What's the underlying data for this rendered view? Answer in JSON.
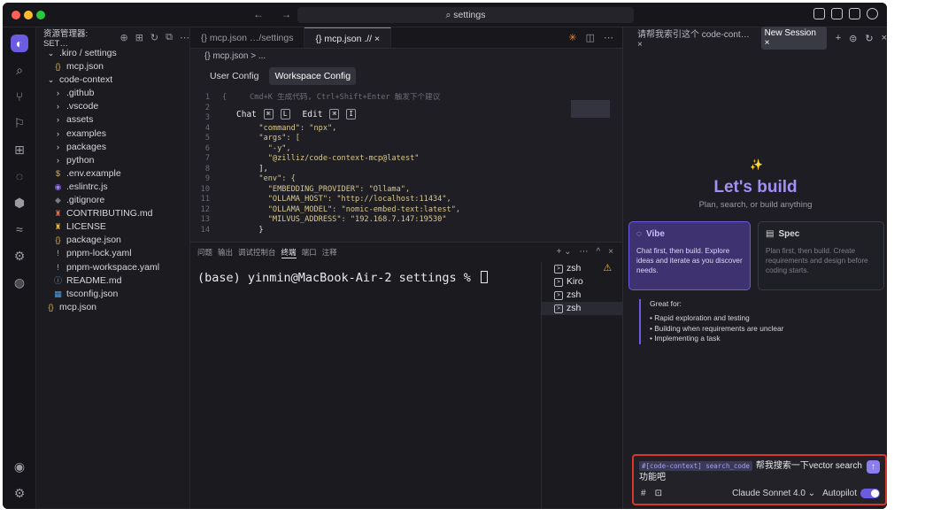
{
  "titlebar": {
    "search_text": "⌕ settings",
    "nav_arrows": "← →",
    "colors": {
      "close": "#ff5f57",
      "minimize": "#febc2e",
      "maximize": "#28c840"
    }
  },
  "activity": {
    "icons": [
      "kiro-logo-icon",
      "search-icon",
      "source-control-icon",
      "run-debug-icon",
      "extensions-icon",
      "ghost-icon",
      "shield-icon",
      "mcp-icon",
      "plugin-icon",
      "power-icon"
    ],
    "glyphs": [
      "◐",
      "⌕",
      "⑂",
      "⚐",
      "⊞",
      "◌",
      "⬢",
      "≈",
      "⚙",
      "◍"
    ],
    "bottom_glyphs": [
      "◉",
      "⚙"
    ]
  },
  "explorer": {
    "title": "资源管理器: SET…",
    "header_icons": [
      "⊕",
      "⊞",
      "↻",
      "⧉",
      "⋯"
    ],
    "items": [
      {
        "indent": 1,
        "icon": "⌄",
        "label": ".kiro / settings",
        "color": "#d6d6dc"
      },
      {
        "indent": 2,
        "icon": "{}",
        "label": "mcp.json",
        "color": "#e3b341"
      },
      {
        "indent": 1,
        "icon": "⌄",
        "label": "code-context",
        "color": "#d6d6dc"
      },
      {
        "indent": 2,
        "icon": "›",
        "label": ".github",
        "color": "#d6d6dc"
      },
      {
        "indent": 2,
        "icon": "›",
        "label": ".vscode",
        "color": "#d6d6dc"
      },
      {
        "indent": 2,
        "icon": "›",
        "label": "assets",
        "color": "#d6d6dc"
      },
      {
        "indent": 2,
        "icon": "›",
        "label": "examples",
        "color": "#d6d6dc"
      },
      {
        "indent": 2,
        "icon": "›",
        "label": "packages",
        "color": "#d6d6dc"
      },
      {
        "indent": 2,
        "icon": "›",
        "label": "python",
        "color": "#d6d6dc"
      },
      {
        "indent": 2,
        "icon": "$",
        "label": ".env.example",
        "color": "#e3b341"
      },
      {
        "indent": 2,
        "icon": "◉",
        "label": ".eslintrc.js",
        "color": "#9b7cf0"
      },
      {
        "indent": 2,
        "icon": "◆",
        "label": ".gitignore",
        "color": "#7a7a84"
      },
      {
        "indent": 2,
        "icon": "♜",
        "label": "CONTRIBUTING.md",
        "color": "#e06c4c"
      },
      {
        "indent": 2,
        "icon": "♜",
        "label": "LICENSE",
        "color": "#e3b341"
      },
      {
        "indent": 2,
        "icon": "{}",
        "label": "package.json",
        "color": "#e3b341"
      },
      {
        "indent": 2,
        "icon": "!",
        "label": "pnpm-lock.yaml",
        "color": "#e3b341"
      },
      {
        "indent": 2,
        "icon": "!",
        "label": "pnpm-workspace.yaml",
        "color": "#e3b341"
      },
      {
        "indent": 2,
        "icon": "ⓘ",
        "label": "README.md",
        "color": "#4ea1e8"
      },
      {
        "indent": 2,
        "icon": "▦",
        "label": "tsconfig.json",
        "color": "#4ea1e8"
      },
      {
        "indent": 1,
        "icon": "{}",
        "label": "mcp.json",
        "color": "#e3b341"
      }
    ]
  },
  "editor": {
    "tabs": [
      {
        "label": "{} mcp.json …/settings",
        "active": false
      },
      {
        "label": "{} mcp.json .// ×",
        "active": true
      }
    ],
    "tab_actions": [
      "✳",
      "◫",
      "⋯"
    ],
    "breadcrumb": "{} mcp.json > ...",
    "config_tabs": [
      "User Config",
      "Workspace Config"
    ],
    "chat_hint": {
      "chat": "Chat",
      "chat_keys": [
        "⌘",
        "L"
      ],
      "edit": "Edit",
      "edit_keys": [
        "⌘",
        "I"
      ]
    },
    "lines": [
      {
        "n": "1",
        "text": "{     Cmd+K 生成代码, Ctrl+Shift+Enter 触发下个建议"
      },
      {
        "n": "2",
        "text": ""
      },
      {
        "n": "3",
        "text": ""
      },
      {
        "n": "4",
        "text": "        \"command\": \"npx\","
      },
      {
        "n": "5",
        "text": "        \"args\": ["
      },
      {
        "n": "6",
        "text": "          \"-y\","
      },
      {
        "n": "7",
        "text": "          \"@zilliz/code-context-mcp@latest\""
      },
      {
        "n": "8",
        "text": "        ],"
      },
      {
        "n": "9",
        "text": "        \"env\": {"
      },
      {
        "n": "10",
        "text": "          \"EMBEDDING_PROVIDER\": \"Ollama\","
      },
      {
        "n": "11",
        "text": "          \"OLLAMA_HOST\": \"http://localhost:11434\","
      },
      {
        "n": "12",
        "text": "          \"OLLAMA_MODEL\": \"nomic-embed-text:latest\","
      },
      {
        "n": "13",
        "text": "          \"MILVUS_ADDRESS\": \"192.168.7.147:19530\""
      },
      {
        "n": "14",
        "text": "        }"
      }
    ]
  },
  "terminal": {
    "tabs": [
      "问题",
      "输出",
      "调试控制台",
      "终端",
      "端口",
      "注释"
    ],
    "active_tab": "终端",
    "actions": [
      "+ ⌄",
      "⋯",
      "^",
      "×"
    ],
    "prompt": "(base) yinmin@MacBook-Air-2 settings % ",
    "sessions": [
      "zsh",
      "Kiro",
      "zsh",
      "zsh"
    ],
    "warn_glyph": "⚠"
  },
  "panel": {
    "tabs": [
      "请帮我索引这个 code-cont…  ×",
      "New Session  ×"
    ],
    "actions": [
      "+",
      "⊜",
      "↻",
      "×"
    ],
    "sparkle": "✨",
    "headline": "Let's build",
    "subtitle": "Plan, search, or build anything",
    "vibe": {
      "title": "Vibe",
      "icon": "◌",
      "desc": "Chat first, then build. Explore ideas and iterate as you discover needs."
    },
    "spec": {
      "title": "Spec",
      "icon": "▤",
      "desc": "Plan first, then build. Create requirements and design before coding starts."
    },
    "great_for_title": "Great for:",
    "great_for": [
      "Rapid exploration and testing",
      "Building when requirements are unclear",
      "Implementing a task"
    ],
    "input": {
      "context_tag": "#[code-context] search_code",
      "text": "帮我搜索一下vector search功能吧",
      "hash": "#",
      "image_icon": "⊡",
      "model": "Claude Sonnet 4.0 ⌄",
      "autopilot": "Autopilot",
      "send": "↑"
    }
  }
}
